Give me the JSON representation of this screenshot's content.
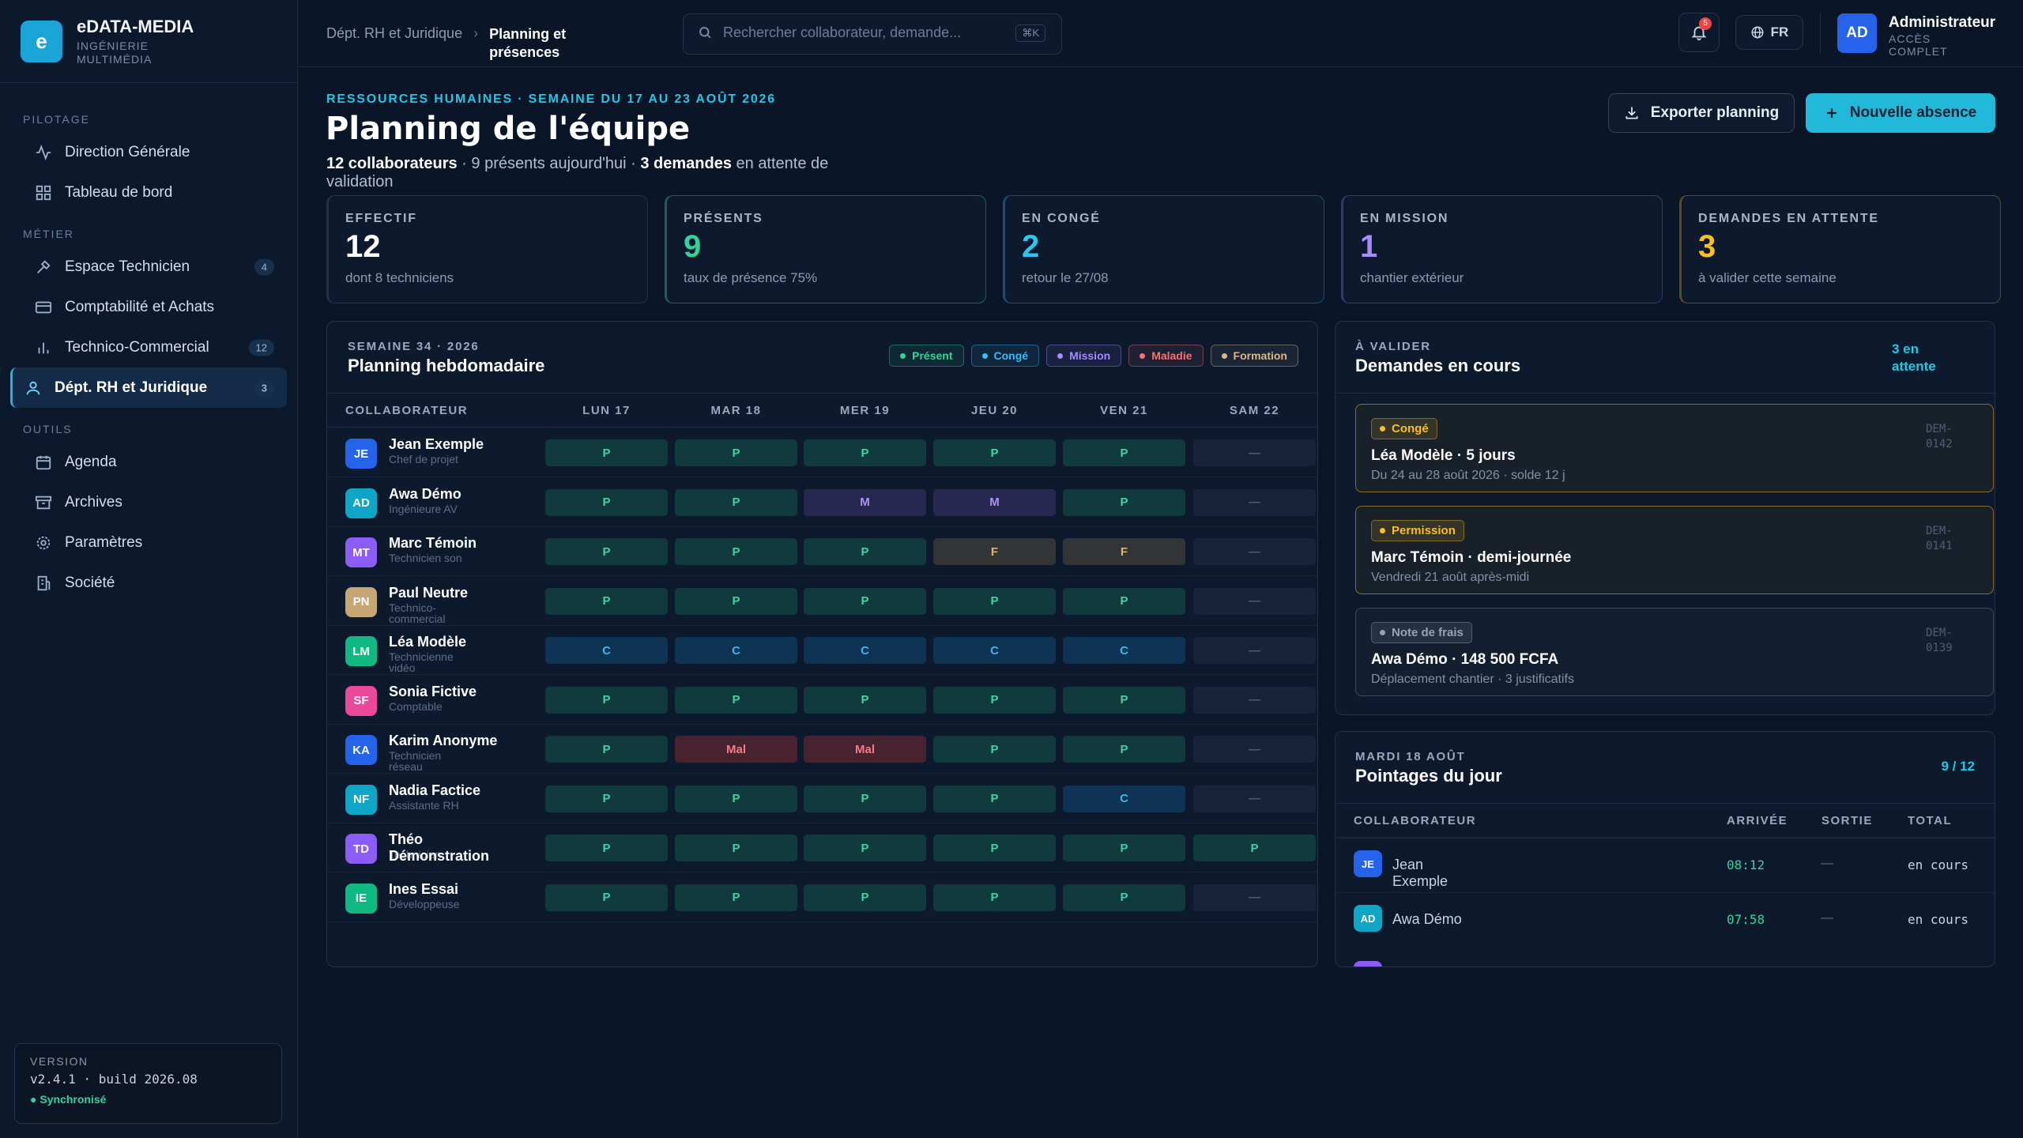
{
  "brand": {
    "logo_letter": "e",
    "name": "eDATA-MEDIA",
    "subtitle": "Ingénierie multimédia"
  },
  "sidebar": {
    "sections": [
      {
        "label": "Pilotage",
        "items": [
          {
            "label": "Direction Générale",
            "icon": "activity-icon"
          },
          {
            "label": "Tableau de bord",
            "icon": "grid-icon"
          }
        ]
      },
      {
        "label": "Métier",
        "items": [
          {
            "label": "Espace Technicien",
            "icon": "tool-icon",
            "badge": "4"
          },
          {
            "label": "Comptabilité et Achats",
            "icon": "card-icon"
          },
          {
            "label": "Technico-Commercial",
            "icon": "bar-chart-icon",
            "badge": "12"
          },
          {
            "label": "Dépt. RH et Juridique",
            "icon": "user-icon",
            "badge": "3",
            "active": true
          }
        ]
      },
      {
        "label": "Outils",
        "items": [
          {
            "label": "Agenda",
            "icon": "calendar-icon"
          },
          {
            "label": "Archives",
            "icon": "archive-icon"
          },
          {
            "label": "Paramètres",
            "icon": "gear-icon"
          },
          {
            "label": "Société",
            "icon": "building-icon"
          }
        ]
      }
    ],
    "version": {
      "label": "Version",
      "value": "v2.4.1 · build 2026.08",
      "status": "Synchronisé"
    }
  },
  "topbar": {
    "breadcrumb": {
      "parent": "Dépt. RH et Juridique",
      "current": "Planning et présences"
    },
    "search": {
      "placeholder": "Rechercher collaborateur, demande...",
      "shortcut": "⌘K"
    },
    "notifications_count": "5",
    "language": "FR",
    "user": {
      "initials": "AD",
      "name": "Administrateur",
      "role": "Accès complet"
    }
  },
  "page": {
    "eyebrow": "Ressources humaines · Semaine du 17 au 23 août 2026",
    "title": "Planning de l'équipe",
    "summary": {
      "count": "12 collaborateurs",
      "present": " · 9 présents aujourd'hui · ",
      "pending": "3 demandes",
      "tail": " en attente de validation"
    },
    "export_label": "Exporter planning",
    "new_label": "Nouvelle absence"
  },
  "kpis": [
    {
      "label": "Effectif",
      "value": "12",
      "note": "dont 8 techniciens",
      "color": "#ffffff",
      "border": "#22324b"
    },
    {
      "label": "Présents",
      "value": "9",
      "note": "taux de présence 75%",
      "color": "#34d399",
      "border": "#1f5f57"
    },
    {
      "label": "En congé",
      "value": "2",
      "note": "retour le 27/08",
      "color": "#2ec6ee",
      "border": "#1d4f6d"
    },
    {
      "label": "En mission",
      "value": "1",
      "note": "chantier extérieur",
      "color": "#a78bfa",
      "border": "#3a3670"
    },
    {
      "label": "Demandes en attente",
      "value": "3",
      "note": "à valider cette semaine",
      "color": "#fbbf24",
      "border": "#5b4a2a"
    }
  ],
  "planning": {
    "eyebrow": "Semaine 34 · 2026",
    "title": "Planning hebdomadaire",
    "legend": [
      {
        "label": "Présent",
        "color": "#34d399"
      },
      {
        "label": "Congé",
        "color": "#38bdf8"
      },
      {
        "label": "Mission",
        "color": "#a78bfa"
      },
      {
        "label": "Maladie",
        "color": "#f87171"
      },
      {
        "label": "Formation",
        "color": "#d6b88a"
      }
    ],
    "columns": [
      "Collaborateur",
      "Lun 17",
      "Mar 18",
      "Mer 19",
      "Jeu 20",
      "Ven 21",
      "Sam 22"
    ],
    "rows": [
      {
        "initials": "JE",
        "name": "Jean Exemple",
        "role": "Chef de projet",
        "color": "#2563eb",
        "days": [
          "P",
          "P",
          "P",
          "P",
          "P",
          "—"
        ]
      },
      {
        "initials": "AD",
        "name": "Awa Démo",
        "role": "Ingénieure AV",
        "color": "#0ea5c6",
        "days": [
          "P",
          "P",
          "M",
          "M",
          "P",
          "—"
        ]
      },
      {
        "initials": "MT",
        "name": "Marc Témoin",
        "role": "Technicien son",
        "color": "#8b5cf6",
        "days": [
          "P",
          "P",
          "P",
          "F",
          "F",
          "—"
        ]
      },
      {
        "initials": "PN",
        "name": "Paul Neutre",
        "role": "Technico-commercial",
        "color": "#c8a574",
        "days": [
          "P",
          "P",
          "P",
          "P",
          "P",
          "—"
        ]
      },
      {
        "initials": "LM",
        "name": "Léa Modèle",
        "role": "Technicienne vidéo",
        "color": "#10b981",
        "days": [
          "C",
          "C",
          "C",
          "C",
          "C",
          "—"
        ]
      },
      {
        "initials": "SF",
        "name": "Sonia Fictive",
        "role": "Comptable",
        "color": "#ec4899",
        "days": [
          "P",
          "P",
          "P",
          "P",
          "P",
          "—"
        ]
      },
      {
        "initials": "KA",
        "name": "Karim Anonyme",
        "role": "Technicien réseau",
        "color": "#2563eb",
        "days": [
          "P",
          "Mal",
          "Mal",
          "P",
          "P",
          "—"
        ]
      },
      {
        "initials": "NF",
        "name": "Nadia Factice",
        "role": "Assistante RH",
        "color": "#0ea5c6",
        "days": [
          "P",
          "P",
          "P",
          "P",
          "C",
          "—"
        ]
      },
      {
        "initials": "TD",
        "name": "Théo Démonstration",
        "role": "Technicien",
        "color": "#8b5cf6",
        "days": [
          "P",
          "P",
          "P",
          "P",
          "P",
          "P"
        ]
      },
      {
        "initials": "IE",
        "name": "Ines Essai",
        "role": "Développeuse",
        "color": "#10b981",
        "days": [
          "P",
          "P",
          "P",
          "P",
          "P",
          "—"
        ]
      }
    ]
  },
  "requests": {
    "eyebrow": "À valider",
    "title": "Demandes en cours",
    "count": "3 en attente",
    "items": [
      {
        "tag": "Congé",
        "tag_color": "#fbbf24",
        "title": "Léa Modèle · 5 jours",
        "sub": "Du 24 au 28 août 2026 · solde 12 j",
        "id": "DEM-0142",
        "border": "#8a6d2c",
        "bg": "#18202a"
      },
      {
        "tag": "Permission",
        "tag_color": "#fbbf24",
        "title": "Marc Témoin · demi-journée",
        "sub": "Vendredi 21 août après-midi",
        "id": "DEM-0141",
        "border": "#8a6d2c",
        "bg": "#18202a"
      },
      {
        "tag": "Note de frais",
        "tag_color": "#94a3b8",
        "title": "Awa Démo · 148 500 FCFA",
        "sub": "Déplacement chantier · 3 justificatifs",
        "id": "DEM-0139",
        "border": "#3b4a62",
        "bg": "#131f31"
      }
    ]
  },
  "pointages": {
    "eyebrow": "Mardi 18 août",
    "title": "Pointages du jour",
    "count": "9 / 12",
    "columns": [
      "Collaborateur",
      "Arrivée",
      "Sortie",
      "Total"
    ],
    "rows": [
      {
        "initials": "JE",
        "name": "Jean Exemple",
        "color": "#2563eb",
        "arrival": "08:12",
        "exit": "—",
        "total": "en cours"
      },
      {
        "initials": "AD",
        "name": "Awa Démo",
        "color": "#0ea5c6",
        "arrival": "07:58",
        "exit": "—",
        "total": "en cours"
      }
    ]
  }
}
